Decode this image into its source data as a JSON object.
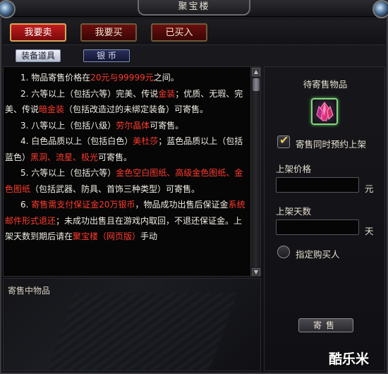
{
  "window": {
    "title": "聚宝楼"
  },
  "tabs": [
    {
      "label": "我要卖",
      "active": true
    },
    {
      "label": "我要买",
      "active": false
    },
    {
      "label": "已买入",
      "active": false
    }
  ],
  "subtabs": [
    {
      "label": "装备道具",
      "active": true
    },
    {
      "label": "银  币",
      "active": false
    }
  ],
  "info": {
    "p1": [
      "1.  物品寄售价格在",
      "20元与99999元",
      "之间。"
    ],
    "p2": [
      "2.  六等以上（包括六等）完美、传说",
      "金装",
      "；优质、无瑕、完美、传说",
      "暗金装",
      "（包括改造过的未绑定装备）可寄售。"
    ],
    "p3": [
      "3.  八等以上（包括八级）",
      "劳尔晶体",
      "可寄售。"
    ],
    "p4": [
      "4.  白色品质以上（包括白色）",
      "美杜莎",
      "；蓝色品质以上（包括蓝色）",
      "黑洞、流星、极光",
      "可寄售。"
    ],
    "p5": [
      "5.  六等以上（包括六等）",
      "金色空白图纸、高级金色图纸、金色图纸",
      "（包括武器、防具、首饰三种类型）可寄售。"
    ],
    "p6": [
      "6.  ",
      "寄售需支付保证金20万银币",
      "，物品成功出售后保证金",
      "系统邮件形式退还",
      "；未成功出售且在游戏内取回，不退还保证金。上架天数到期后请在",
      "聚宝楼（网页版）",
      "手动"
    ]
  },
  "selling": {
    "label": "寄售中物品"
  },
  "right": {
    "title": "待寄售物品",
    "item_icon": "crystal-icon",
    "reserve_label": "寄售同时预约上架",
    "reserve_checked": true,
    "price_label": "上架价格",
    "price_value": "",
    "price_unit": "元",
    "days_label": "上架天数",
    "days_value": "",
    "days_unit": "天",
    "buyer_label": "指定购买人",
    "buyer_checked": false,
    "sell_button": "寄售"
  },
  "watermark": "酷乐米"
}
